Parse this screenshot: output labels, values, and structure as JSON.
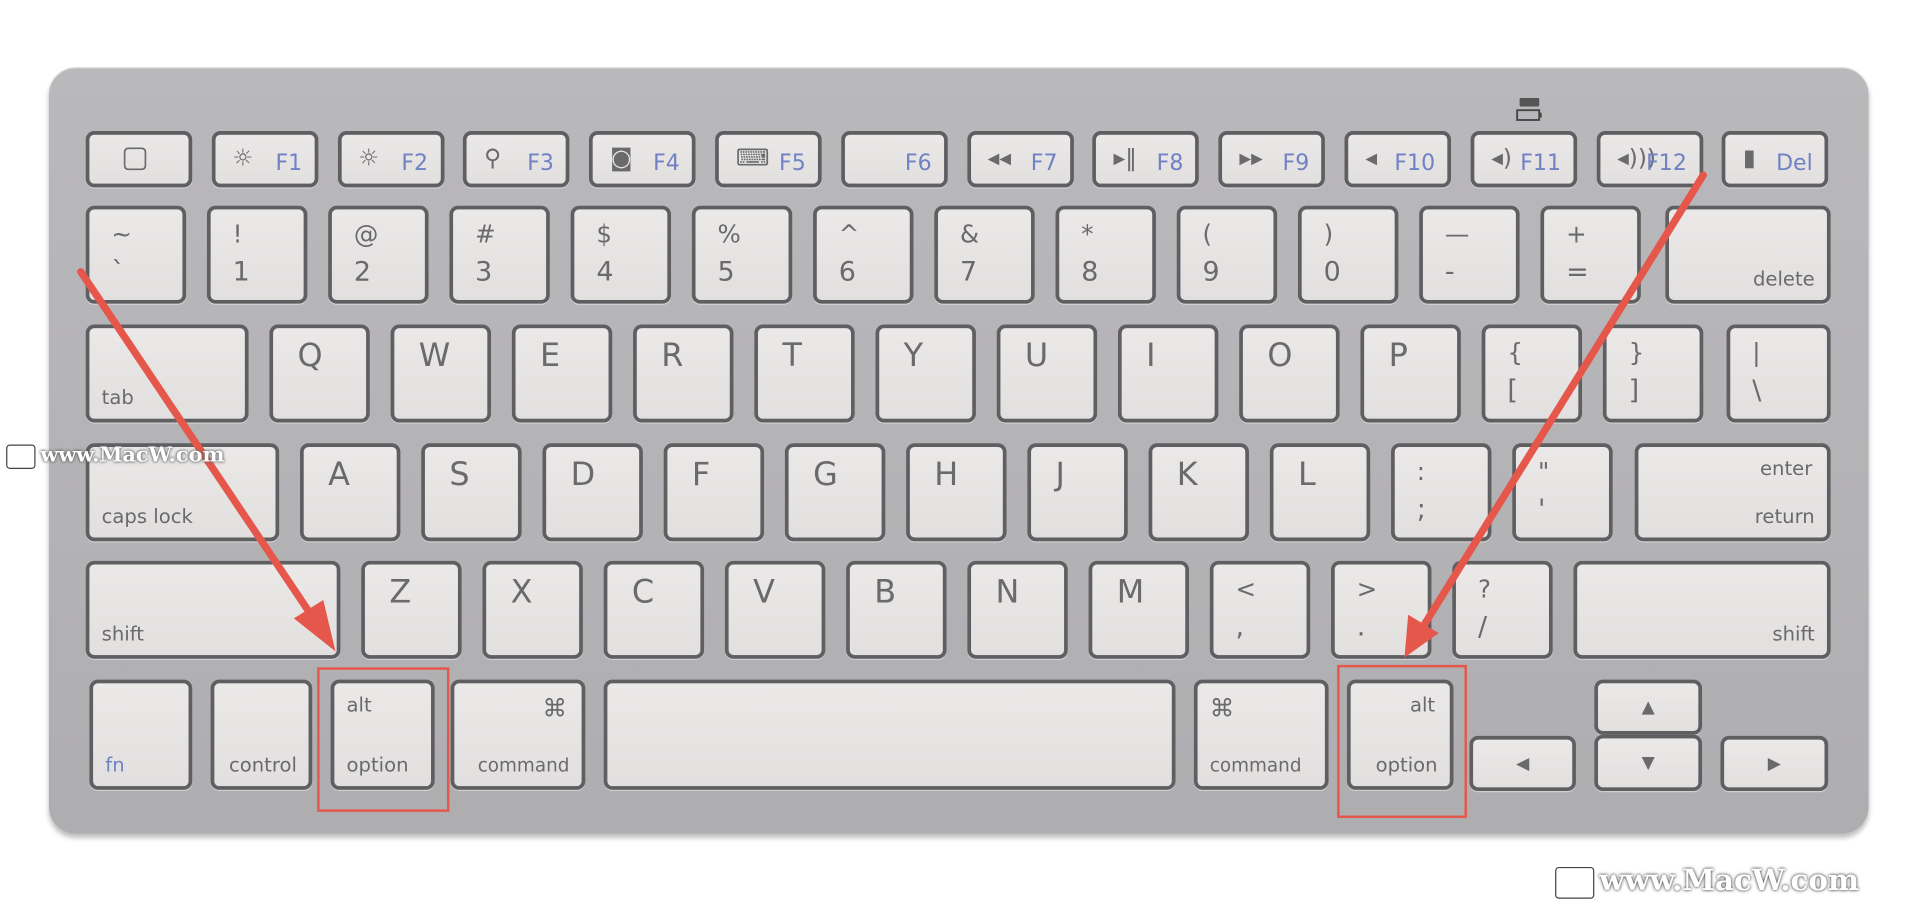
{
  "keyboard": {
    "function_row": [
      {
        "icon": "eject-square-icon",
        "label": ""
      },
      {
        "icon": "brightness-down-icon",
        "label": "F1"
      },
      {
        "icon": "brightness-up-icon",
        "label": "F2"
      },
      {
        "icon": "search-icon",
        "label": "F3"
      },
      {
        "icon": "dashboard-icon",
        "label": "F4"
      },
      {
        "icon": "keyboard-icon",
        "label": "F5"
      },
      {
        "icon": "",
        "label": "F6"
      },
      {
        "icon": "rewind-icon",
        "label": "F7"
      },
      {
        "icon": "play-pause-icon",
        "label": "F8"
      },
      {
        "icon": "fast-forward-icon",
        "label": "F9"
      },
      {
        "icon": "mute-icon",
        "label": "F10"
      },
      {
        "icon": "volume-down-icon",
        "label": "F11"
      },
      {
        "icon": "volume-up-icon",
        "label": "F12"
      },
      {
        "icon": "lock-icon",
        "label": "Del"
      }
    ],
    "battery_indicator": "battery-icon",
    "number_row": [
      {
        "top": "~",
        "bottom": "`"
      },
      {
        "top": "!",
        "bottom": "1"
      },
      {
        "top": "@",
        "bottom": "2"
      },
      {
        "top": "#",
        "bottom": "3"
      },
      {
        "top": "$",
        "bottom": "4"
      },
      {
        "top": "%",
        "bottom": "5"
      },
      {
        "top": "^",
        "bottom": "6"
      },
      {
        "top": "&",
        "bottom": "7"
      },
      {
        "top": "*",
        "bottom": "8"
      },
      {
        "top": "(",
        "bottom": "9"
      },
      {
        "top": ")",
        "bottom": "0"
      },
      {
        "top": "—",
        "bottom": "-"
      },
      {
        "top": "+",
        "bottom": "="
      }
    ],
    "delete_label": "delete",
    "tab_label": "tab",
    "qwerty_row": [
      "Q",
      "W",
      "E",
      "R",
      "T",
      "Y",
      "U",
      "I",
      "O",
      "P"
    ],
    "bracket_keys": [
      {
        "top": "{",
        "bottom": "["
      },
      {
        "top": "}",
        "bottom": "]"
      }
    ],
    "backslash_key": {
      "top": "|",
      "bottom": "\\"
    },
    "caps_label": "caps lock",
    "home_row": [
      "A",
      "S",
      "D",
      "F",
      "G",
      "H",
      "J",
      "K",
      "L"
    ],
    "home_punct": [
      {
        "top": ":",
        "bottom": ";"
      },
      {
        "top": "\"",
        "bottom": "'"
      }
    ],
    "enter_label": "enter",
    "return_label": "return",
    "shift_label": "shift",
    "bottom_letters": [
      "Z",
      "X",
      "C",
      "V",
      "B",
      "N",
      "M"
    ],
    "bottom_punct": [
      {
        "top": "<",
        "bottom": ","
      },
      {
        "top": ">",
        "bottom": "."
      },
      {
        "top": "?",
        "bottom": "/"
      }
    ],
    "modifiers": {
      "fn": "fn",
      "control": "control",
      "alt": "alt",
      "option": "option",
      "command": "command",
      "command_symbol": "⌘"
    },
    "arrows": {
      "up": "▲",
      "down": "▼",
      "left": "◀",
      "right": "▶"
    }
  },
  "annotations": {
    "color": "#e5574a",
    "highlighted_keys": [
      "left-option",
      "right-option"
    ]
  },
  "watermark": {
    "text": "www.MacW.com"
  }
}
